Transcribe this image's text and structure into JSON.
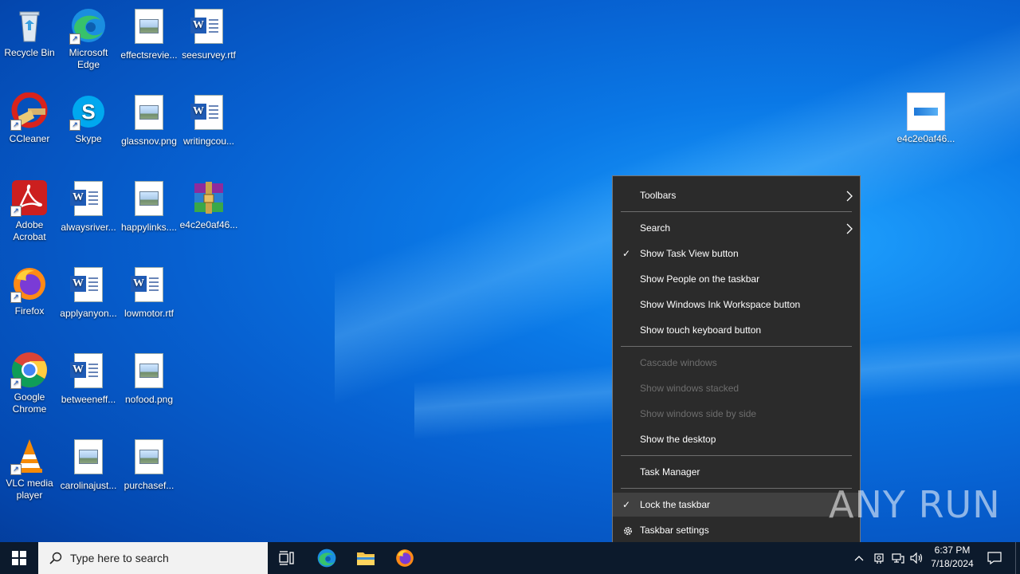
{
  "desktop": {
    "icons": [
      {
        "label": "Recycle Bin",
        "kind": "recycle-bin"
      },
      {
        "label": "Microsoft Edge",
        "kind": "edge"
      },
      {
        "label": "effectsrevie...",
        "kind": "image-file"
      },
      {
        "label": "seesurvey.rtf",
        "kind": "word-file"
      },
      {
        "label": "CCleaner",
        "kind": "ccleaner"
      },
      {
        "label": "Skype",
        "kind": "skype"
      },
      {
        "label": "glassnov.png",
        "kind": "image-file"
      },
      {
        "label": "writingcou...",
        "kind": "word-file"
      },
      {
        "label": "Adobe Acrobat",
        "kind": "acrobat"
      },
      {
        "label": "alwaysriver...",
        "kind": "word-file"
      },
      {
        "label": "happylinks....",
        "kind": "image-file"
      },
      {
        "label": "e4c2e0af46...",
        "kind": "winrar-archive"
      },
      {
        "label": "Firefox",
        "kind": "firefox"
      },
      {
        "label": "applyanyon...",
        "kind": "word-file"
      },
      {
        "label": "lowmotor.rtf",
        "kind": "word-file"
      },
      {
        "label": "Google Chrome",
        "kind": "chrome"
      },
      {
        "label": "betweeneff...",
        "kind": "word-file"
      },
      {
        "label": "nofood.png",
        "kind": "image-file"
      },
      {
        "label": "VLC media player",
        "kind": "vlc"
      },
      {
        "label": "carolinajust...",
        "kind": "image-file"
      },
      {
        "label": "purchasef...",
        "kind": "image-file"
      },
      {
        "label": "e4c2e0af46...",
        "kind": "windows-thumbnail"
      }
    ]
  },
  "context_menu": {
    "toolbars": "Toolbars",
    "search": "Search",
    "show_task_view": "Show Task View button",
    "show_people": "Show People on the taskbar",
    "show_ink": "Show Windows Ink Workspace button",
    "show_touch_keyboard": "Show touch keyboard button",
    "cascade": "Cascade windows",
    "stacked": "Show windows stacked",
    "side_by_side": "Show windows side by side",
    "show_desktop": "Show the desktop",
    "task_manager": "Task Manager",
    "lock_taskbar": "Lock the taskbar",
    "taskbar_settings": "Taskbar settings",
    "check_glyph": "✓",
    "submenu_glyph": "›"
  },
  "watermark": "ANY RUN",
  "taskbar": {
    "search_placeholder": "Type here to search",
    "time": "6:37 PM",
    "date": "7/18/2024",
    "tray_chevron": "^"
  },
  "colors": {
    "menu_bg": "#2b2b2b",
    "menu_highlight": "#414141",
    "taskbar_bg": "#0c1a2c",
    "desktop_accent": "#0a78e6"
  }
}
